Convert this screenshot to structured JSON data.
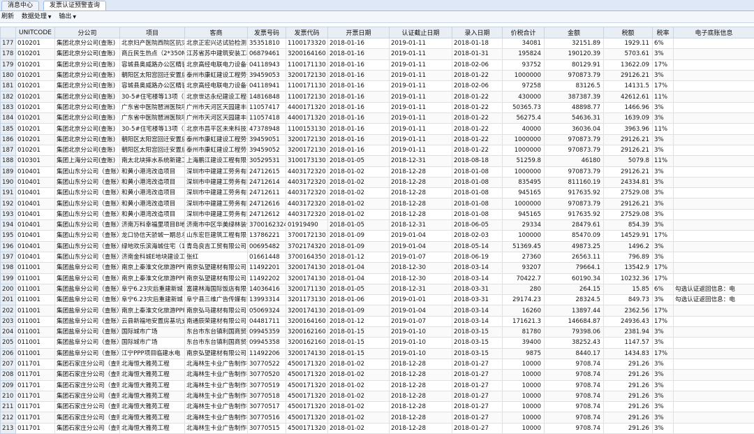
{
  "tabs": [
    "消息中心",
    "发票认证预警查询"
  ],
  "toolbar": {
    "refresh": "刷新",
    "data_process": "数据处理",
    "output": "输出"
  },
  "columns": [
    "UNITCODE",
    "分公司",
    "项目",
    "客商",
    "发票号码",
    "发票代码",
    "开票日期",
    "认证截止日期",
    "录入日期",
    "价税合计",
    "金额",
    "税额",
    "税率",
    "电子底账信息"
  ],
  "rows": [
    [
      "177",
      "010201",
      "集团北京分公司(查账)",
      "北京妇产医院西院区抗灾",
      "北京正宏兴达试验检测",
      "35351810",
      "1100173320",
      "2018-01-16",
      "2019-01-11",
      "2018-01-18",
      "34081",
      "32151.89",
      "1929.11",
      "6%",
      ""
    ],
    [
      "178",
      "010201",
      "集团北京分公司(查账)",
      "商丘民生热点（2*350MW",
      "江苏省苏中建筑安装工程",
      "06879461",
      "3200164160",
      "2018-01-16",
      "2019-01-11",
      "2018-01-31",
      "195824",
      "190120.39",
      "5703.61",
      "3%",
      ""
    ],
    [
      "179",
      "010201",
      "集团北京分公司(查账)",
      "容城县奥威路办公区精装",
      "北京高经电联电力设备有",
      "04118943",
      "1100171130",
      "2018-01-16",
      "2019-01-11",
      "2018-02-06",
      "93752",
      "80129.91",
      "13622.09",
      "17%",
      ""
    ],
    [
      "180",
      "010201",
      "集团北京分公司(查账)",
      "朝阳区太阳宫回迁安置房",
      "泰州市康虹建设工程劳务",
      "39459053",
      "3200172130",
      "2018-01-16",
      "2019-01-11",
      "2018-01-22",
      "1000000",
      "970873.79",
      "29126.21",
      "3%",
      ""
    ],
    [
      "181",
      "010201",
      "集团北京分公司(查账)",
      "容城县奥威路办公区精装",
      "北京高经电联电力设备有",
      "04118941",
      "1100171130",
      "2018-01-16",
      "2019-01-11",
      "2018-02-06",
      "97258",
      "83126.5",
      "14131.5",
      "17%",
      ""
    ],
    [
      "182",
      "010201",
      "集团北京分公司(查账)",
      "30-5#住宅楼等13项（配",
      "北京世达永纪建设工程有",
      "14816848",
      "1100172130",
      "2018-01-16",
      "2019-01-11",
      "2018-01-22",
      "430000",
      "387387.39",
      "42612.61",
      "11%",
      ""
    ],
    [
      "183",
      "010201",
      "集团北京分公司(查账)",
      "广东省中医院琶洲医院项",
      "广州市天河区天园建丰装",
      "11057417",
      "4400171320",
      "2018-01-16",
      "2019-01-11",
      "2018-01-22",
      "50365.73",
      "48898.77",
      "1466.96",
      "3%",
      ""
    ],
    [
      "184",
      "010201",
      "集团北京分公司(查账)",
      "广东省中医院琶洲医院项",
      "广州市天河区天园建丰装",
      "11057418",
      "4400171320",
      "2018-01-16",
      "2019-01-11",
      "2018-01-22",
      "56275.4",
      "54636.31",
      "1639.09",
      "3%",
      ""
    ],
    [
      "185",
      "010201",
      "集团北京分公司(查账)",
      "30-5#住宅楼等13项（配",
      "北京市昌平区未来科技城",
      "47378948",
      "1100153130",
      "2018-01-16",
      "2019-01-11",
      "2018-01-22",
      "40000",
      "36036.04",
      "3963.96",
      "11%",
      ""
    ],
    [
      "186",
      "010201",
      "集团北京分公司(查账)",
      "朝阳区太阳宫回迁安置房",
      "泰州市康虹建设工程劳务",
      "39459051",
      "3200172130",
      "2018-01-16",
      "2019-01-11",
      "2018-01-22",
      "1000000",
      "970873.79",
      "29126.21",
      "3%",
      ""
    ],
    [
      "187",
      "010201",
      "集团北京分公司(查账)",
      "朝阳区太阳宫回迁安置房",
      "泰州市康虹建设工程劳务",
      "39459052",
      "3200172130",
      "2018-01-16",
      "2019-01-11",
      "2018-01-22",
      "1000000",
      "970873.79",
      "29126.21",
      "3%",
      ""
    ],
    [
      "188",
      "010301",
      "集团上海分公司(查账)",
      "南太北块摔水系统新建工",
      "上海鹏江建设工程有限公",
      "30529531",
      "3100173130",
      "2018-01-05",
      "2018-12-31",
      "2018-08-18",
      "51259.8",
      "46180",
      "5079.8",
      "11%",
      ""
    ],
    [
      "189",
      "010401",
      "集团山东分公司（查账）",
      "和黄小港湾改造项目",
      "深圳市中建建工劳务有限",
      "24712615",
      "4403172320",
      "2018-01-02",
      "2018-12-28",
      "2018-01-08",
      "1000000",
      "970873.79",
      "29126.21",
      "3%",
      ""
    ],
    [
      "190",
      "010401",
      "集团山东分公司（查账）",
      "和黄小港湾改造项目",
      "深圳市中建建工劳务有限",
      "24712614",
      "4403172320",
      "2018-01-02",
      "2018-12-28",
      "2018-01-08",
      "835495",
      "811160.19",
      "24334.81",
      "3%",
      ""
    ],
    [
      "191",
      "010401",
      "集团山东分公司（查账）",
      "和黄小港湾改造项目",
      "深圳市中建建工劳务有限",
      "24712611",
      "4403172320",
      "2018-01-02",
      "2018-12-28",
      "2018-01-08",
      "945165",
      "917635.92",
      "27529.08",
      "3%",
      ""
    ],
    [
      "192",
      "010401",
      "集团山东分公司（查账）",
      "和黄小港湾改造项目",
      "深圳市中建建工劳务有限",
      "24712616",
      "4403172320",
      "2018-01-02",
      "2018-12-28",
      "2018-01-08",
      "1000000",
      "970873.79",
      "29126.21",
      "3%",
      ""
    ],
    [
      "193",
      "010401",
      "集团山东分公司（查账）",
      "和黄小港湾改造项目",
      "深圳市中建建工劳务有限",
      "24712612",
      "4403172320",
      "2018-01-02",
      "2018-12-28",
      "2018-01-08",
      "945165",
      "917635.92",
      "27529.08",
      "3%",
      ""
    ],
    [
      "194",
      "010401",
      "集团山东分公司（查账）",
      "济南万科幸福里项目B地",
      "济南市中区华美绿林装饰",
      "3700162324",
      "01919490",
      "2018-01-05",
      "2018-12-31",
      "2018-06-05",
      "29334",
      "28479.61",
      "854.39",
      "3%",
      ""
    ],
    [
      "195",
      "010401",
      "集团山东分公司（查账）",
      "龙口协信天骄城一期总承",
      "山东宏巨建筑工程有限公",
      "13786221",
      "3700172130",
      "2018-01-09",
      "2019-01-04",
      "2018-02-03",
      "100000",
      "85470.09",
      "14529.91",
      "17%",
      ""
    ],
    [
      "196",
      "010401",
      "集团山东分公司（查账）",
      "绿地欢乐滨海城住宅（1",
      "青岛良吉工贸有限公司",
      "00695482",
      "3702174320",
      "2018-01-09",
      "2019-01-04",
      "2018-05-14",
      "51369.45",
      "49873.25",
      "1496.2",
      "3%",
      ""
    ],
    [
      "197",
      "010401",
      "集团山东分公司（查账）",
      "济南金科城E地块建设工",
      "张红",
      "01661448",
      "3700164350",
      "2018-01-12",
      "2019-01-07",
      "2018-06-19",
      "27360",
      "26563.11",
      "796.89",
      "3%",
      ""
    ],
    [
      "198",
      "011001",
      "集团盐阜分公司（查账）",
      "南京上秦淮文化旅游PPP",
      "南京弘望建材有限公司",
      "11492201",
      "3200174130",
      "2018-01-04",
      "2018-12-30",
      "2018-03-14",
      "93207",
      "79664.1",
      "13542.9",
      "17%",
      ""
    ],
    [
      "199",
      "011001",
      "集团盐阜分公司（查账）",
      "南京上秦淮文化旅游PPP",
      "南京弘望建材有限公司",
      "11492202",
      "3200174130",
      "2018-01-04",
      "2018-12-30",
      "2018-03-14",
      "70422.7",
      "60190.34",
      "10232.36",
      "17%",
      ""
    ],
    [
      "200",
      "011001",
      "集团盐阜分公司（查账）",
      "阜宁6.23灾后重建新城",
      "富建林海国际饭店有限公",
      "14036416",
      "3200171130",
      "2018-01-05",
      "2018-12-31",
      "2018-03-31",
      "280",
      "264.15",
      "15.85",
      "6%",
      "勾选认证返回信息：电"
    ],
    [
      "201",
      "011001",
      "集团盐阜分公司（查账）",
      "阜宁6.23灾后重建新城",
      "阜宁县三维广告传媒有限",
      "13993314",
      "3201173130",
      "2018-01-06",
      "2019-01-01",
      "2018-03-31",
      "29174.23",
      "28324.5",
      "849.73",
      "3%",
      "勾选认证返回信息：电"
    ],
    [
      "202",
      "011001",
      "集团盐阜分公司（查账）",
      "南京上秦淮文化旅游PPP",
      "南京弘马建材有限公司",
      "05069324",
      "3200174130",
      "2018-01-09",
      "2019-01-04",
      "2018-03-14",
      "16260",
      "13897.44",
      "2362.56",
      "17%",
      ""
    ],
    [
      "203",
      "011001",
      "集团盐阜分公司（查账）",
      "云县新福地安置房基坑支",
      "南通辰荣建材有限公司",
      "04481711",
      "3200164160",
      "2018-01-12",
      "2019-01-07",
      "2018-03-14",
      "171621.3",
      "146684.87",
      "24936.43",
      "17%",
      ""
    ],
    [
      "204",
      "011001",
      "集团盐阜分公司（查账）",
      "国际城市广场",
      "东台市东台镇利国商贸部",
      "09945359",
      "3200162160",
      "2018-01-15",
      "2019-01-10",
      "2018-03-15",
      "81780",
      "79398.06",
      "2381.94",
      "3%",
      ""
    ],
    [
      "205",
      "011001",
      "集团盐阜分公司（查账）",
      "国际城市广场",
      "东台市东台镇利国商贸部",
      "09945358",
      "3200162160",
      "2018-01-15",
      "2019-01-10",
      "2018-03-15",
      "39400",
      "38252.43",
      "1147.57",
      "3%",
      ""
    ],
    [
      "206",
      "011001",
      "集团盐阜分公司（查账）",
      "江宁PPP项目临建水电",
      "南京弘望建材有限公司",
      "11492206",
      "3200174130",
      "2018-01-15",
      "2019-01-10",
      "2018-03-15",
      "9875",
      "8440.17",
      "1434.83",
      "17%",
      ""
    ],
    [
      "207",
      "011701",
      "集团石家庄分公司（查账）",
      "北海恒大雅苑工程",
      "北海林生卡业广告制作有",
      "30770522",
      "4500171320",
      "2018-01-02",
      "2018-12-28",
      "2018-01-27",
      "10000",
      "9708.74",
      "291.26",
      "3%",
      ""
    ],
    [
      "208",
      "011701",
      "集团石家庄分公司（查账）",
      "北海恒大雅苑工程",
      "北海林生卡业广告制作有",
      "30770520",
      "4500171320",
      "2018-01-02",
      "2018-12-28",
      "2018-01-27",
      "10000",
      "9708.74",
      "291.26",
      "3%",
      ""
    ],
    [
      "209",
      "011701",
      "集团石家庄分公司（查账）",
      "北海恒大雅苑工程",
      "北海林生卡业广告制作有",
      "30770519",
      "4500171320",
      "2018-01-02",
      "2018-12-28",
      "2018-01-27",
      "10000",
      "9708.74",
      "291.26",
      "3%",
      ""
    ],
    [
      "210",
      "011701",
      "集团石家庄分公司（查账）",
      "北海恒大雅苑工程",
      "北海林生卡业广告制作有",
      "30770518",
      "4500171320",
      "2018-01-02",
      "2018-12-28",
      "2018-01-27",
      "10000",
      "9708.74",
      "291.26",
      "3%",
      ""
    ],
    [
      "211",
      "011701",
      "集团石家庄分公司（查账）",
      "北海恒大雅苑工程",
      "北海林生卡业广告制作有",
      "30770517",
      "4500171320",
      "2018-01-02",
      "2018-12-28",
      "2018-01-27",
      "10000",
      "9708.74",
      "291.26",
      "3%",
      ""
    ],
    [
      "212",
      "011701",
      "集团石家庄分公司（查账）",
      "北海恒大雅苑工程",
      "北海林生卡业广告制作有",
      "30770516",
      "4500171320",
      "2018-01-02",
      "2018-12-28",
      "2018-01-27",
      "10000",
      "9708.74",
      "291.26",
      "3%",
      ""
    ],
    [
      "213",
      "011701",
      "集团石家庄分公司（查账）",
      "北海恒大雅苑工程",
      "北海林生卡业广告制作有",
      "30770515",
      "4500171320",
      "2018-01-02",
      "2018-12-28",
      "2018-01-27",
      "10000",
      "9708.74",
      "291.26",
      "3%",
      ""
    ]
  ]
}
